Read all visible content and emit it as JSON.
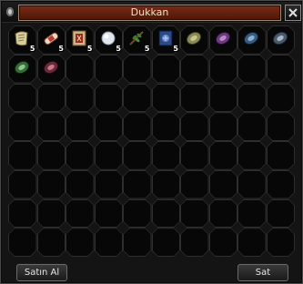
{
  "window": {
    "title": "Dukkan"
  },
  "slots": [
    {
      "icon": "scroll-icon",
      "count": "5"
    },
    {
      "icon": "bandage-icon",
      "count": "5"
    },
    {
      "icon": "book-icon",
      "count": "5"
    },
    {
      "icon": "crystal-orb-icon",
      "count": "5"
    },
    {
      "icon": "herb-branch-icon",
      "count": "5"
    },
    {
      "icon": "blue-book-icon",
      "count": "5"
    },
    {
      "icon": "olive-gem-icon",
      "count": ""
    },
    {
      "icon": "purple-gem-icon",
      "count": ""
    },
    {
      "icon": "blue-gem-icon",
      "count": ""
    },
    {
      "icon": "slate-gem-icon",
      "count": ""
    },
    {
      "icon": "green-gem-icon",
      "count": ""
    },
    {
      "icon": "crimson-gem-icon",
      "count": ""
    }
  ],
  "buttons": {
    "buy": "Satın Al",
    "sell": "Sat"
  },
  "colors": {
    "title_bar": "#6a2410",
    "title_text": "#f0e2c2",
    "slot_border": "#2e2e2e"
  }
}
